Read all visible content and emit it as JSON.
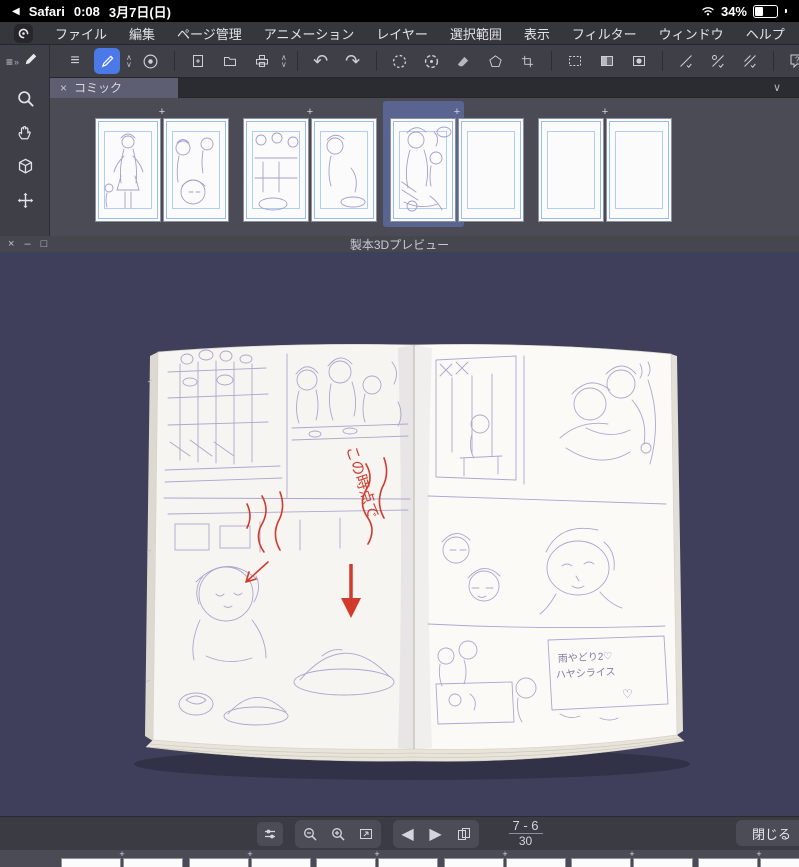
{
  "status_bar": {
    "back_app": "Safari",
    "time": "0:08",
    "date": "3月7日(日)",
    "battery_percent": "34%"
  },
  "menu_bar": {
    "items": [
      "ファイル",
      "編集",
      "ページ管理",
      "アニメーション",
      "レイヤー",
      "選択範囲",
      "表示",
      "フィルター",
      "ウィンドウ",
      "ヘルプ"
    ]
  },
  "tab_bar": {
    "active_tab": "コミック"
  },
  "preview_window": {
    "title": "製本3Dプレビュー",
    "page_current": "7 - 6",
    "page_total": "30",
    "close_label": "閉じる"
  },
  "book_annotations": {
    "red_note": "この時点で",
    "note_line1": "雨やどり2♡",
    "note_line2": "ハヤシライス"
  },
  "glyphs": {
    "menu": "≡",
    "chevrons": "»",
    "close": "×",
    "minimize": "–",
    "maximize": "□",
    "chev_up": "∧",
    "chev_down": "∨",
    "undo": "↶",
    "redo": "↷",
    "prev": "◀",
    "next": "▶",
    "help": "?",
    "reg_mark": "+",
    "heart": "♡",
    "back": "◀"
  }
}
